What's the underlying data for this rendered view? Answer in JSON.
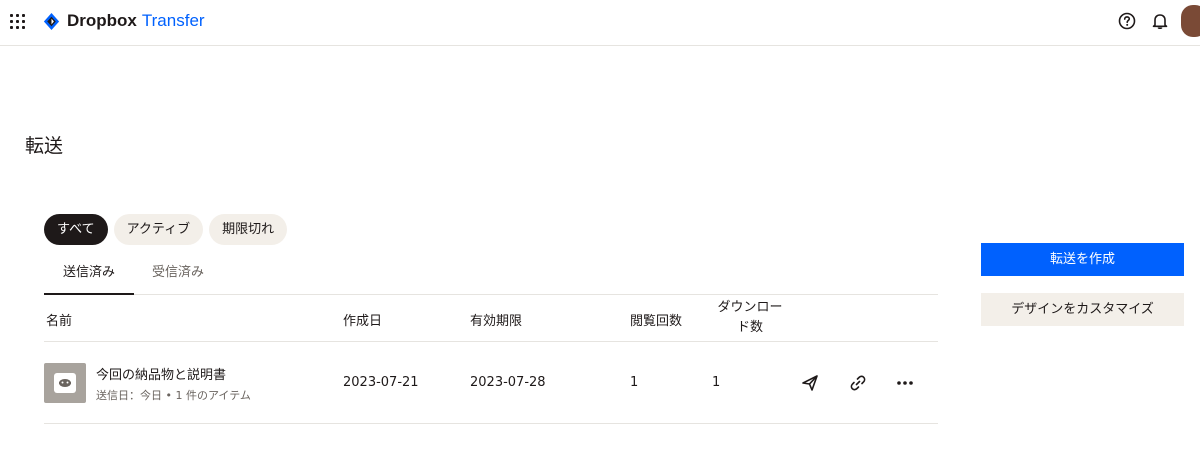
{
  "header": {
    "brand_bold": "Dropbox",
    "brand_light": "Transfer",
    "accent_color": "#0061fe"
  },
  "page": {
    "title": "転送"
  },
  "filters": {
    "all": "すべて",
    "active": "アクティブ",
    "expired": "期限切れ",
    "selected": "すべて"
  },
  "tabs": {
    "sent": "送信済み",
    "received": "受信済み",
    "selected": "送信済み"
  },
  "table": {
    "headers": {
      "name": "名前",
      "created": "作成日",
      "expires": "有効期限",
      "views": "閲覧回数",
      "downloads_line1": "ダウンロー",
      "downloads_line2": "ド数"
    },
    "rows": [
      {
        "name": "今回の納品物と説明書",
        "sub": "送信日：今日 • 1 件のアイテム",
        "created": "2023-07-21",
        "expires": "2023-07-28",
        "views": "1",
        "downloads": "1",
        "actions": [
          "send-icon",
          "link-icon",
          "more-icon"
        ]
      }
    ]
  },
  "buttons": {
    "create_transfer": "転送を作成",
    "customize_design": "デザインをカスタマイズ"
  }
}
